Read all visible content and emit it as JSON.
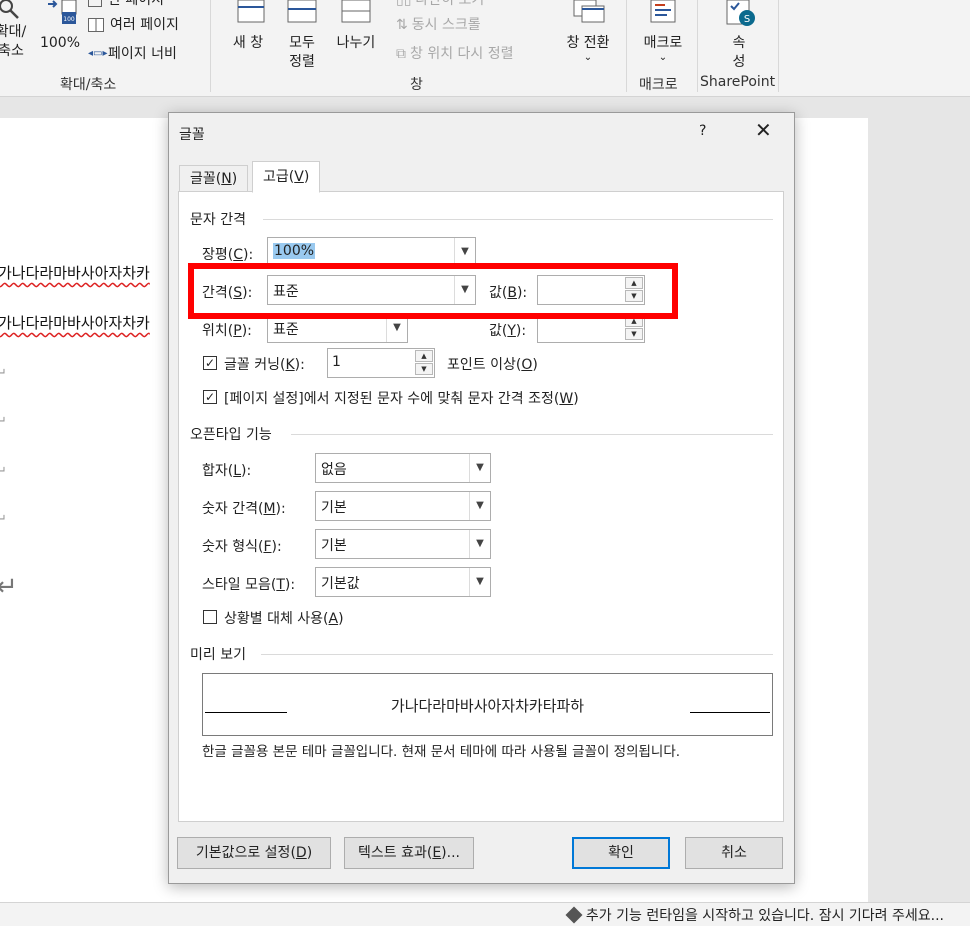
{
  "ribbon": {
    "zoom_label": "확대/\n축소",
    "hundred_label": "100%",
    "one_page": "한 페이지",
    "multi_page": "여러 페이지",
    "page_width": "페이지 너비",
    "group_zoom": "확대/축소",
    "new_window": "새 창",
    "arrange_all": "모두\n정렬",
    "split": "나누기",
    "side_by_side": "나란히 보기",
    "sync_scroll": "동시 스크롤",
    "reset_pos": "창 위치 다시 정렬",
    "switch_windows": "창 전환",
    "group_window": "창",
    "macros": "매크로",
    "group_macros": "매크로",
    "properties": "속\n성",
    "group_sharepoint": "SharePoint"
  },
  "document": {
    "line1": "가나다라마바사아자차카",
    "line2": "가나다라마바사아자차카",
    "para_mark": "↵",
    "big_mark": "↵"
  },
  "dialog": {
    "title": "글꼴",
    "help": "?",
    "close": "✕",
    "tab_font": "글꼴(N)",
    "tab_advanced": "고급(V)",
    "char_spacing": {
      "section": "문자 간격",
      "scale_label": "장평(C):",
      "scale_value": "100%",
      "spacing_label": "간격(S):",
      "spacing_value": "표준",
      "spacing_by_label": "값(B):",
      "spacing_by_value": "",
      "position_label": "위치(P):",
      "position_value": "표준",
      "position_by_label": "값(Y):",
      "position_by_value": "",
      "kerning_label": "글꼴 커닝(K):",
      "kerning_value": "1",
      "kerning_suffix": "포인트 이상(O)",
      "kerning_checked": true,
      "grid_label": "[페이지 설정]에서 지정된 문자 수에 맞춰 문자 간격 조정(W)",
      "grid_checked": true
    },
    "opentype": {
      "section": "오픈타입 기능",
      "ligatures_label": "합자(L):",
      "ligatures_value": "없음",
      "numspacing_label": "숫자 간격(M):",
      "numspacing_value": "기본",
      "numforms_label": "숫자 형식(F):",
      "numforms_value": "기본",
      "stylistic_label": "스타일 모음(T):",
      "stylistic_value": "기본값",
      "contextual_label": "상황별 대체 사용(A)",
      "contextual_checked": false
    },
    "preview": {
      "section": "미리 보기",
      "sample": "가나다라마바사아자차카타파하",
      "note": "한글 글꼴용 본문 테마 글꼴입니다. 현재 문서 테마에 따라 사용될 글꼴이 정의됩니다."
    },
    "buttons": {
      "default": "기본값으로 설정(D)",
      "text_effects": "텍스트 효과(E)...",
      "ok": "확인",
      "cancel": "취소"
    },
    "highlight_color": "#ff0000"
  },
  "status": {
    "text": "추가 기능 런타임을 시작하고 있습니다. 잠시 기다려 주세요..."
  }
}
